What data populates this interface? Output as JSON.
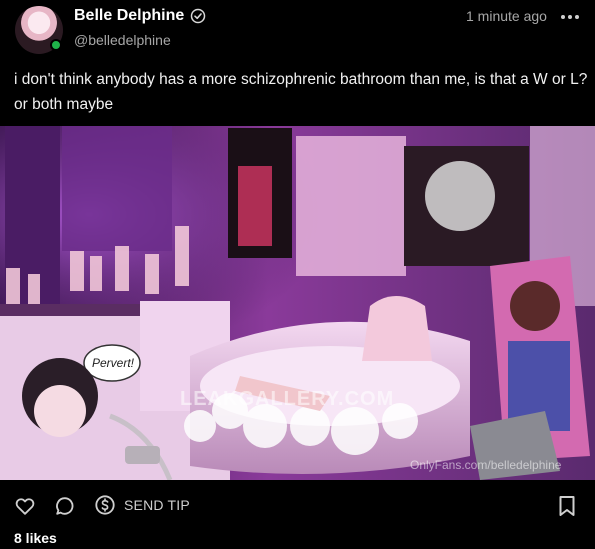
{
  "author": {
    "display_name": "Belle Delphine",
    "handle": "@belledelphine",
    "verified": true,
    "online": true
  },
  "post": {
    "timestamp": "1 minute ago",
    "text": "i don't think anybody has a more schizophrenic bathroom than me, is that a W or L? or both maybe",
    "media": {
      "watermark": "LEAKGALLERY.COM",
      "speech_bubble": "Pervert!",
      "credit": "OnlyFans.com/belledelphine"
    }
  },
  "actions": {
    "send_tip_label": "SEND TIP"
  },
  "likes_text": "8 likes",
  "icons": {
    "verified": "verified-check-icon",
    "more": "more-dots-icon",
    "like": "heart-icon",
    "comment": "comment-icon",
    "tip": "dollar-circle-icon",
    "bookmark": "bookmark-icon"
  },
  "colors": {
    "background": "#000000",
    "online": "#1fb34a",
    "muted_text": "#a7a7a7"
  }
}
